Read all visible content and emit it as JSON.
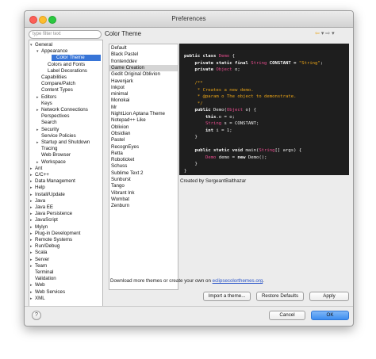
{
  "window": {
    "title": "Preferences"
  },
  "filter_placeholder": "type filter text",
  "tree": [
    {
      "label": "General",
      "twisty": "▾"
    },
    {
      "label": "Appearance",
      "twisty": "▾"
    },
    {
      "label": "Color Theme",
      "twisty": "",
      "selected": true
    },
    {
      "label": "Colors and Fonts",
      "twisty": ""
    },
    {
      "label": "Label Decorations",
      "twisty": ""
    },
    {
      "label": "Capabilities",
      "twisty": ""
    },
    {
      "label": "Compare/Patch",
      "twisty": ""
    },
    {
      "label": "Content Types",
      "twisty": ""
    },
    {
      "label": "Editors",
      "twisty": "▸"
    },
    {
      "label": "Keys",
      "twisty": ""
    },
    {
      "label": "Network Connections",
      "twisty": "▸"
    },
    {
      "label": "Perspectives",
      "twisty": ""
    },
    {
      "label": "Search",
      "twisty": ""
    },
    {
      "label": "Security",
      "twisty": "▸"
    },
    {
      "label": "Service Policies",
      "twisty": ""
    },
    {
      "label": "Startup and Shutdown",
      "twisty": "▸"
    },
    {
      "label": "Tracing",
      "twisty": ""
    },
    {
      "label": "Web Browser",
      "twisty": ""
    },
    {
      "label": "Workspace",
      "twisty": "▸"
    },
    {
      "label": "Ant",
      "twisty": "▸"
    },
    {
      "label": "C/C++",
      "twisty": "▸"
    },
    {
      "label": "Data Management",
      "twisty": "▸"
    },
    {
      "label": "Help",
      "twisty": "▸"
    },
    {
      "label": "Install/Update",
      "twisty": "▸"
    },
    {
      "label": "Java",
      "twisty": "▸"
    },
    {
      "label": "Java EE",
      "twisty": "▸"
    },
    {
      "label": "Java Persistence",
      "twisty": "▸"
    },
    {
      "label": "JavaScript",
      "twisty": "▸"
    },
    {
      "label": "Mylyn",
      "twisty": "▸"
    },
    {
      "label": "Plug-in Development",
      "twisty": "▸"
    },
    {
      "label": "Remote Systems",
      "twisty": "▸"
    },
    {
      "label": "Run/Debug",
      "twisty": "▸"
    },
    {
      "label": "Scala",
      "twisty": "▸"
    },
    {
      "label": "Server",
      "twisty": "▸"
    },
    {
      "label": "Team",
      "twisty": "▸"
    },
    {
      "label": "Terminal",
      "twisty": ""
    },
    {
      "label": "Validation",
      "twisty": ""
    },
    {
      "label": "Web",
      "twisty": "▸"
    },
    {
      "label": "Web Services",
      "twisty": "▸"
    },
    {
      "label": "XML",
      "twisty": "▸"
    }
  ],
  "page_title": "Color Theme",
  "themes": [
    "Default",
    "Black Pastel",
    "frontenddev",
    "Game Creation",
    "Gedit Original Oblivion",
    "Havenjark",
    "Inkpot",
    "minimal",
    "Monokai",
    "Mr",
    "NightLion Aptana Theme",
    "Notepad++ Like",
    "Oblivion",
    "Obsidian",
    "Pastel",
    "RecognEyes",
    "Retta",
    "Roboticket",
    "Schuss",
    "Sublime Text 2",
    "Sunburst",
    "Tango",
    "Vibrant Ink",
    "Wombat",
    "Zenburn"
  ],
  "selected_theme": "Game Creation",
  "code_lines": [
    [
      {
        "t": "public class ",
        "c": "kw"
      },
      {
        "t": "Demo",
        "c": "ty"
      },
      {
        "t": " {",
        "c": ""
      }
    ],
    [
      {
        "t": "    private static final ",
        "c": "kw"
      },
      {
        "t": "String",
        "c": "ty"
      },
      {
        "t": " CONSTANT = ",
        "c": "fi"
      },
      {
        "t": "\"String\"",
        "c": "st"
      },
      {
        "t": ";",
        "c": ""
      }
    ],
    [
      {
        "t": "    private ",
        "c": "kw"
      },
      {
        "t": "Object",
        "c": "ty"
      },
      {
        "t": " o;",
        "c": ""
      }
    ],
    [],
    [
      {
        "t": "    /**",
        "c": "cm"
      }
    ],
    [
      {
        "t": "     * Creates a new demo.",
        "c": "cm"
      }
    ],
    [
      {
        "t": "     * @param o The object to demonstrate.",
        "c": "cm"
      }
    ],
    [
      {
        "t": "     */",
        "c": "cm"
      }
    ],
    [
      {
        "t": "    public ",
        "c": "kw"
      },
      {
        "t": "Demo(",
        "c": ""
      },
      {
        "t": "Object",
        "c": "ty"
      },
      {
        "t": " o) {",
        "c": ""
      }
    ],
    [
      {
        "t": "        this",
        "c": "kw"
      },
      {
        "t": ".o = o;",
        "c": ""
      }
    ],
    [
      {
        "t": "        ",
        "c": ""
      },
      {
        "t": "String",
        "c": "ty"
      },
      {
        "t": " s = CONSTANT;",
        "c": ""
      }
    ],
    [
      {
        "t": "        int ",
        "c": "kw"
      },
      {
        "t": "i = 1;",
        "c": ""
      }
    ],
    [
      {
        "t": "    }",
        "c": ""
      }
    ],
    [],
    [
      {
        "t": "    public static void ",
        "c": "kw"
      },
      {
        "t": "main(",
        "c": ""
      },
      {
        "t": "String",
        "c": "ty"
      },
      {
        "t": "[] args) {",
        "c": ""
      }
    ],
    [
      {
        "t": "        ",
        "c": ""
      },
      {
        "t": "Demo",
        "c": "ty"
      },
      {
        "t": " demo = ",
        "c": ""
      },
      {
        "t": "new ",
        "c": "kw"
      },
      {
        "t": "Demo();",
        "c": ""
      }
    ],
    [
      {
        "t": "    }",
        "c": ""
      }
    ],
    [
      {
        "t": "}",
        "c": ""
      }
    ]
  ],
  "created_by": "Created by SergeantBalthazar",
  "download_text": "Download more themes or create your own on ",
  "download_link": "eclipsecolorthemes.org",
  "download_suffix": ".",
  "buttons": {
    "import": "Import a theme...",
    "restore": "Restore Defaults",
    "apply": "Apply",
    "cancel": "Cancel",
    "ok": "OK"
  },
  "icons": {
    "help": "?",
    "back": "⇦",
    "forward": "⇨",
    "menu": "▾"
  }
}
